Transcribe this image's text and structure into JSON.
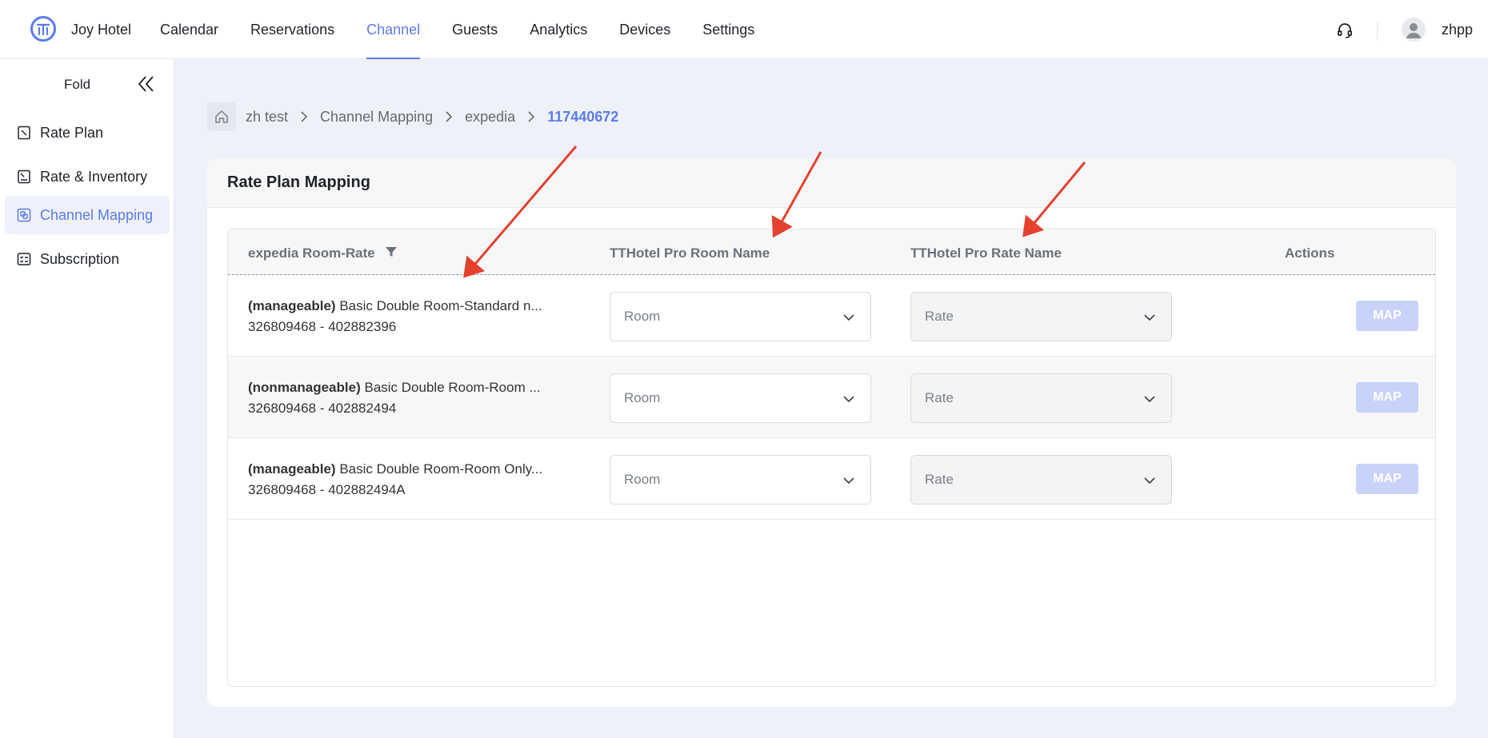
{
  "topbar": {
    "hotel_name": "Joy Hotel",
    "nav": [
      {
        "label": "Calendar",
        "active": false
      },
      {
        "label": "Reservations",
        "active": false
      },
      {
        "label": "Channel",
        "active": true
      },
      {
        "label": "Guests",
        "active": false
      },
      {
        "label": "Analytics",
        "active": false
      },
      {
        "label": "Devices",
        "active": false
      },
      {
        "label": "Settings",
        "active": false
      }
    ],
    "username": "zhpp"
  },
  "sidebar": {
    "fold_label": "Fold",
    "items": [
      {
        "label": "Rate Plan",
        "icon": "rate-plan-icon",
        "active": false
      },
      {
        "label": "Rate & Inventory",
        "icon": "rate-inventory-icon",
        "active": false
      },
      {
        "label": "Channel Mapping",
        "icon": "channel-mapping-icon",
        "active": true
      },
      {
        "label": "Subscription",
        "icon": "subscription-icon",
        "active": false
      }
    ]
  },
  "breadcrumb": {
    "items": [
      "zh test",
      "Channel Mapping",
      "expedia",
      "117440672"
    ]
  },
  "card": {
    "title": "Rate Plan Mapping",
    "columns": {
      "room_rate": "expedia Room-Rate",
      "room_name": "TTHotel Pro Room Name",
      "rate_name": "TTHotel Pro Rate Name",
      "actions": "Actions"
    },
    "rows": [
      {
        "tag": "(manageable)",
        "name": "Basic Double Room-Standard n...",
        "ids": "326809468 - 402882396",
        "room_placeholder": "Room",
        "rate_placeholder": "Rate",
        "action": "MAP"
      },
      {
        "tag": "(nonmanageable)",
        "name": "Basic Double Room-Room ...",
        "ids": "326809468 - 402882494",
        "room_placeholder": "Room",
        "rate_placeholder": "Rate",
        "action": "MAP"
      },
      {
        "tag": "(manageable)",
        "name": "Basic Double Room-Room Only...",
        "ids": "326809468 - 402882494A",
        "room_placeholder": "Room",
        "rate_placeholder": "Rate",
        "action": "MAP"
      }
    ]
  },
  "colors": {
    "accent": "#5b7cf0",
    "map_button": "#c9d2fb",
    "annotation_arrow": "#e5412f"
  }
}
